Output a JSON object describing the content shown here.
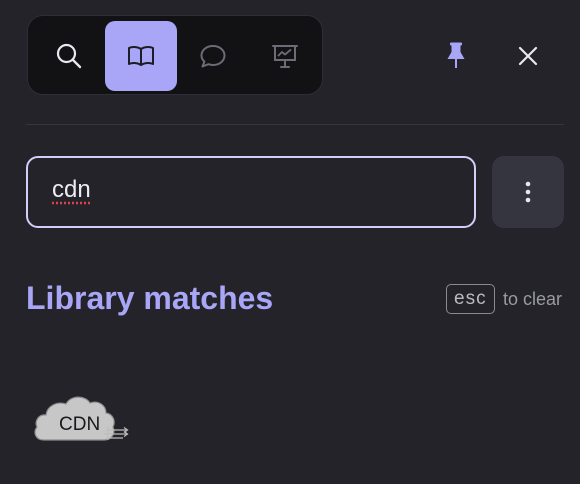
{
  "toolbar": {
    "tabs": [
      {
        "name": "search",
        "icon": "search-icon",
        "active": false
      },
      {
        "name": "library",
        "icon": "book-icon",
        "active": true
      },
      {
        "name": "chat",
        "icon": "chat-bubble-icon",
        "active": false
      },
      {
        "name": "presentation",
        "icon": "presentation-icon",
        "active": false
      }
    ],
    "pin_icon": "pin-icon",
    "close_icon": "close-icon"
  },
  "search": {
    "value": "cdn"
  },
  "results": {
    "heading": "Library matches",
    "esc_key": "esc",
    "esc_hint": "to clear",
    "items": [
      {
        "label": "CDN",
        "icon": "cdn-cloud-icon"
      }
    ]
  },
  "colors": {
    "background": "#232329",
    "accent": "#a9a5f7",
    "toolbar_bg": "#121214",
    "menu_button_bg": "#35353f"
  }
}
